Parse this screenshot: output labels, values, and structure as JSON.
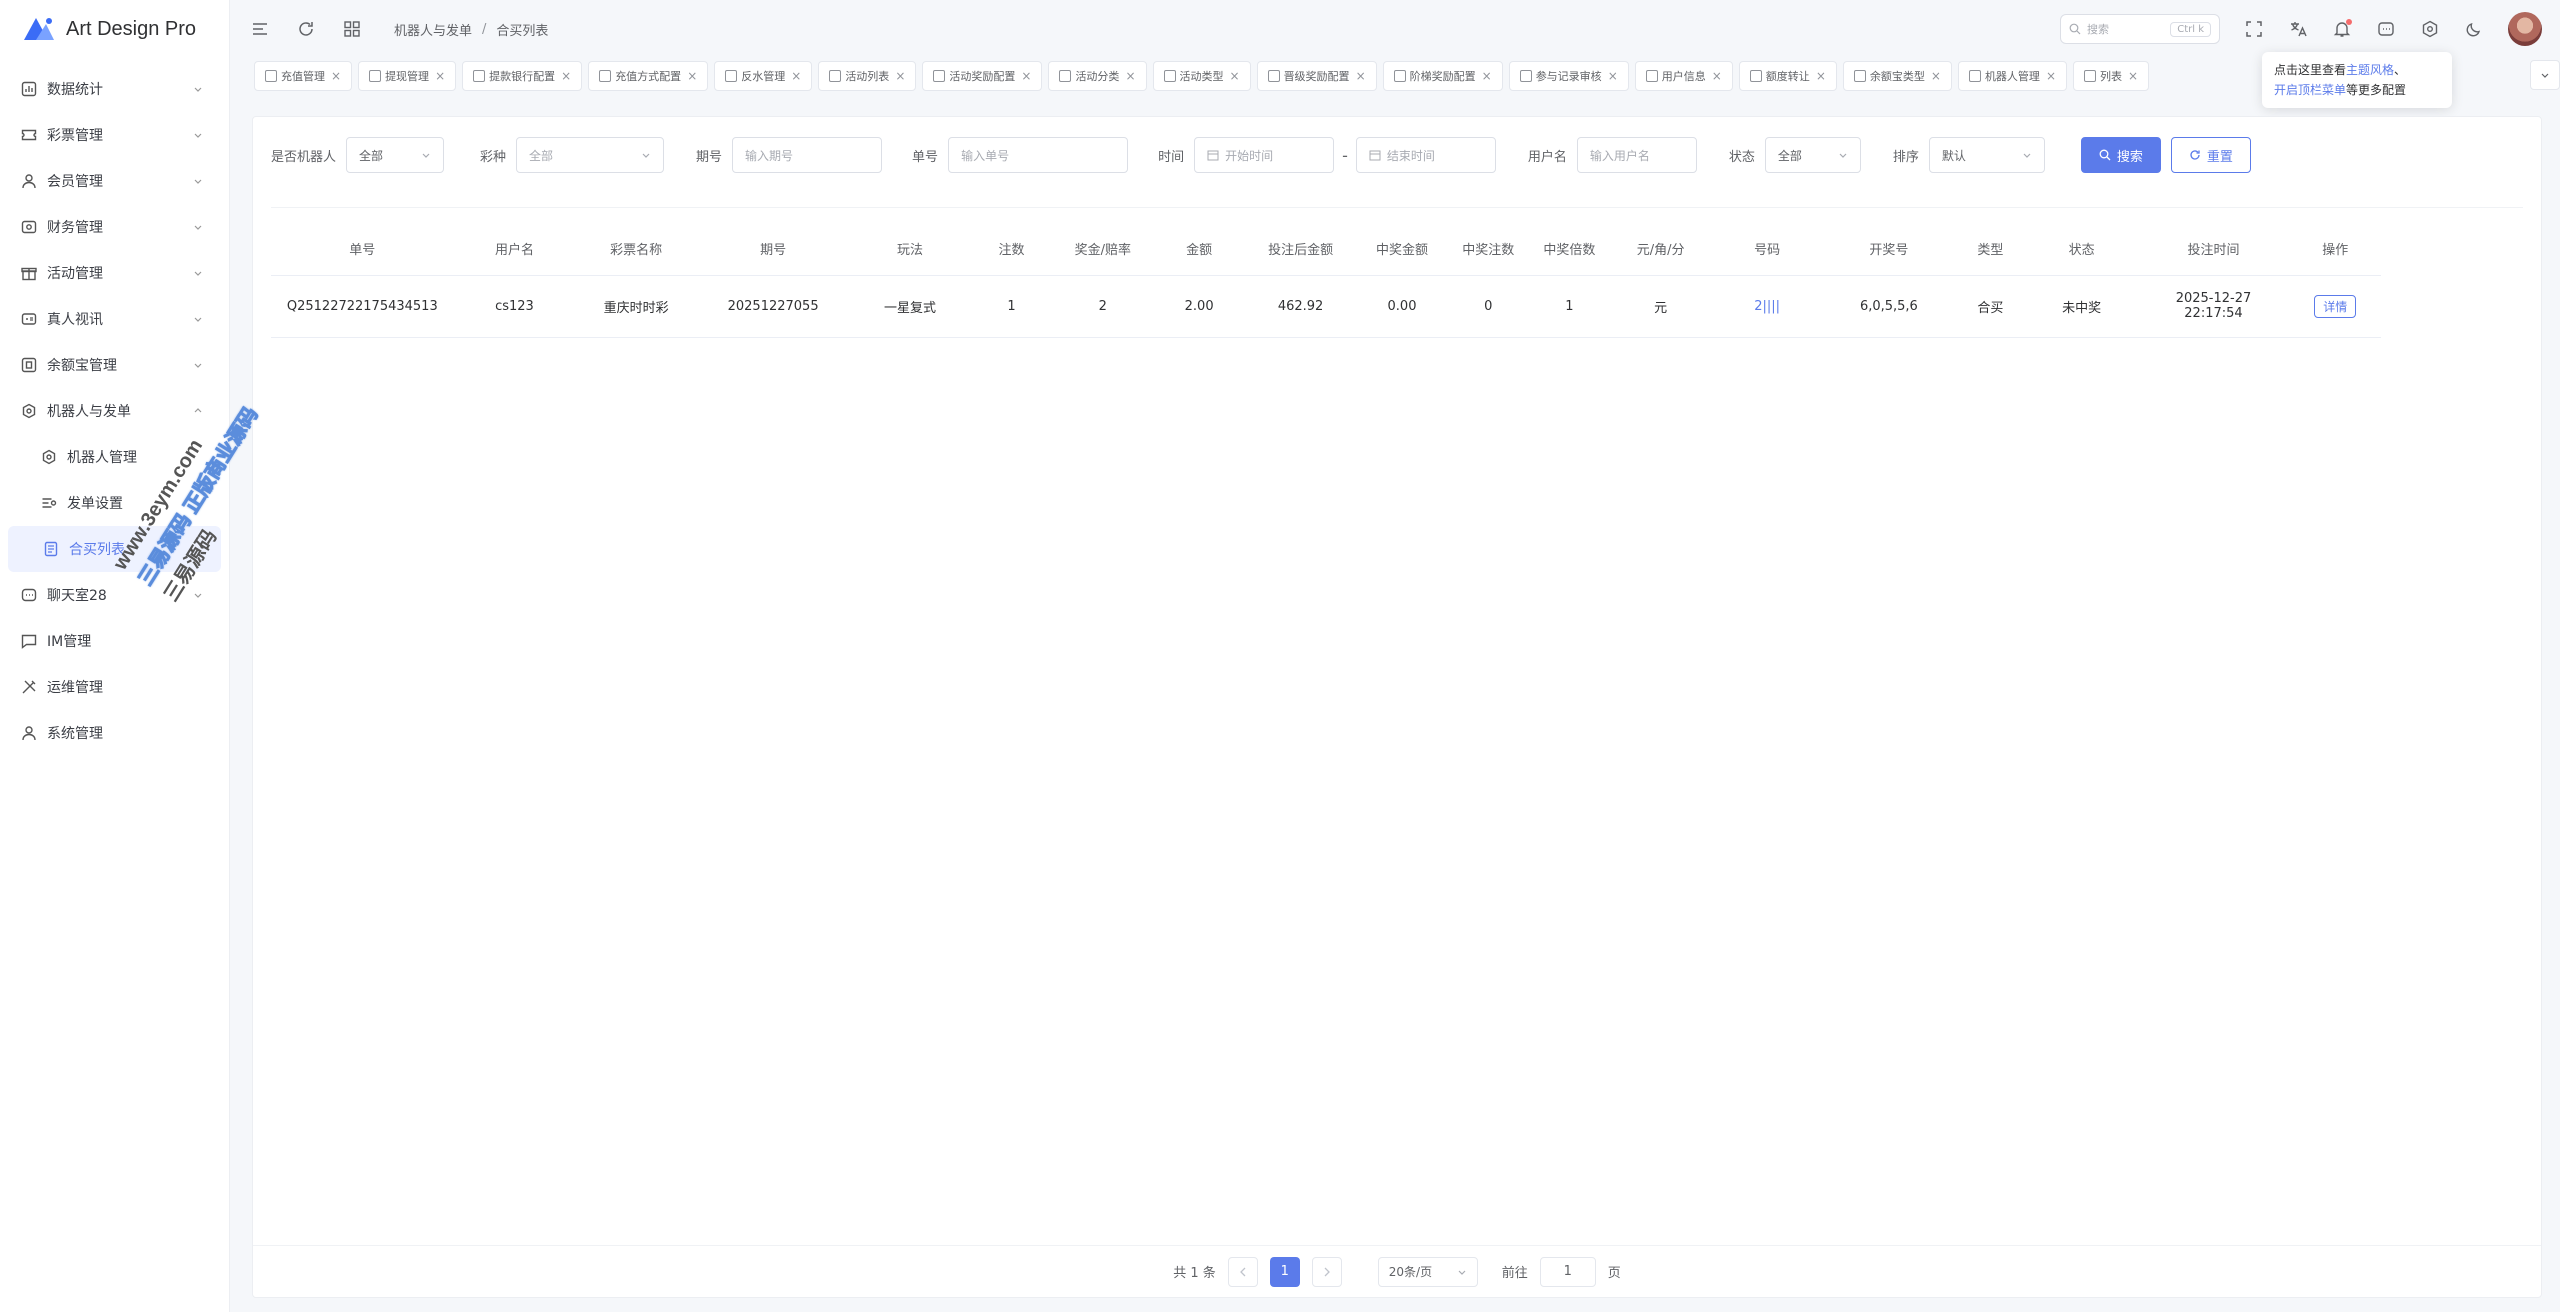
{
  "app": {
    "title": "Art Design Pro"
  },
  "sidebar": {
    "items": [
      {
        "label": "数据统计",
        "icon": "chart-icon"
      },
      {
        "label": "彩票管理",
        "icon": "ticket-icon"
      },
      {
        "label": "会员管理",
        "icon": "user-icon"
      },
      {
        "label": "财务管理",
        "icon": "wallet-icon"
      },
      {
        "label": "活动管理",
        "icon": "gift-icon"
      },
      {
        "label": "真人视讯",
        "icon": "video-icon"
      },
      {
        "label": "余额宝管理",
        "icon": "safe-icon"
      },
      {
        "label": "机器人与发单",
        "icon": "robot-icon"
      },
      {
        "label": "机器人管理",
        "icon": "gear-icon"
      },
      {
        "label": "发单设置",
        "icon": "sliders-icon"
      },
      {
        "label": "合买列表",
        "icon": "list-icon"
      },
      {
        "label": "聊天室28",
        "icon": "chat-icon"
      },
      {
        "label": "IM管理",
        "icon": "message-icon"
      },
      {
        "label": "运维管理",
        "icon": "tools-icon"
      },
      {
        "label": "系统管理",
        "icon": "user-icon"
      }
    ]
  },
  "header": {
    "breadcrumb": [
      "机器人与发单",
      "合买列表"
    ],
    "search_placeholder": "搜索",
    "search_shortcut": "Ctrl k"
  },
  "tabs": [
    "充值管理",
    "提现管理",
    "提款银行配置",
    "充值方式配置",
    "反水管理",
    "活动列表",
    "活动奖励配置",
    "活动分类",
    "活动类型",
    "晋级奖励配置",
    "阶梯奖励配置",
    "参与记录审核",
    "用户信息",
    "额度转让",
    "余额宝类型",
    "机器人管理",
    "列表"
  ],
  "tooltip": {
    "line1_prefix": "点击这里查看",
    "line1_link": "主题风格",
    "line1_suffix": "、",
    "line2_link": "开启顶栏菜单",
    "line2_suffix": "等更多配置"
  },
  "filters": {
    "is_robot": {
      "label": "是否机器人",
      "value": "全部"
    },
    "lottery": {
      "label": "彩种",
      "value": "全部"
    },
    "period": {
      "label": "期号",
      "placeholder": "输入期号"
    },
    "order_no": {
      "label": "单号",
      "placeholder": "输入单号"
    },
    "time": {
      "label": "时间",
      "start_placeholder": "开始时间",
      "end_placeholder": "结束时间",
      "separator": "-"
    },
    "username": {
      "label": "用户名",
      "placeholder": "输入用户名"
    },
    "status": {
      "label": "状态",
      "value": "全部"
    },
    "sort": {
      "label": "排序",
      "value": "默认"
    },
    "search_button": "搜索",
    "reset_button": "重置"
  },
  "table": {
    "headers": [
      "单号",
      "用户名",
      "彩票名称",
      "期号",
      "玩法",
      "注数",
      "奖金/赔率",
      "金额",
      "投注后金额",
      "中奖金额",
      "中奖注数",
      "中奖倍数",
      "元/角/分",
      "号码",
      "开奖号",
      "类型",
      "状态",
      "投注时间",
      "操作"
    ],
    "rows": [
      {
        "order_no": "Q25122722175434513",
        "username": "cs123",
        "lottery": "重庆时时彩",
        "period": "20251227055",
        "play": "一星复式",
        "bets": "1",
        "odds": "2",
        "amount": "2.00",
        "after_amount": "462.92",
        "win_amount": "0.00",
        "win_bets": "0",
        "win_multiple": "1",
        "unit": "元",
        "number": "2||||",
        "draw": "6,0,5,5,6",
        "type": "合买",
        "status": "未中奖",
        "date": "2025-12-27",
        "time": "22:17:54",
        "action": "详情"
      }
    ]
  },
  "pagination": {
    "total": "共 1 条",
    "page": "1",
    "page_size": "20条/页",
    "goto_prefix": "前往",
    "goto_value": "1",
    "goto_suffix": "页"
  },
  "watermark": {
    "line1": "www.3eym.com",
    "line2": "三易源码 正版商业源码",
    "line3": "三易源码"
  },
  "colors": {
    "accent": "#5b7bea",
    "active_bg": "#eef2ff"
  }
}
